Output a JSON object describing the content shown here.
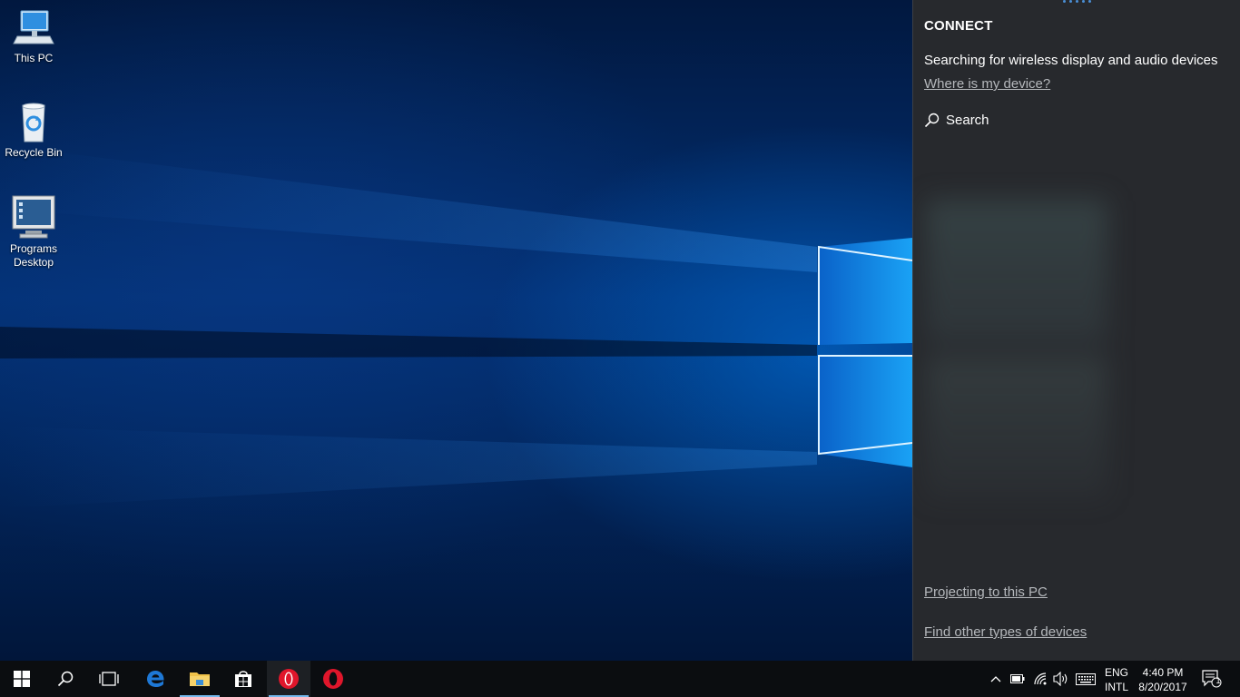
{
  "desktop": {
    "icons": [
      {
        "label": "This PC",
        "icon": "computer-icon"
      },
      {
        "label": "Recycle Bin",
        "icon": "recycle-bin-icon"
      },
      {
        "label": "Programs Desktop",
        "icon": "monitor-icon"
      }
    ]
  },
  "connect_panel": {
    "title": "CONNECT",
    "status": "Searching for wireless display and audio devices",
    "where_link": "Where is my device?",
    "search_label": "Search",
    "projecting_link": "Projecting to this PC",
    "find_link": "Find other types of devices"
  },
  "taskbar": {
    "pinned": [
      {
        "name": "start-button",
        "icon": "windows-logo-icon"
      },
      {
        "name": "search-button",
        "icon": "search-icon"
      },
      {
        "name": "task-view-button",
        "icon": "task-view-icon"
      },
      {
        "name": "edge-button",
        "icon": "edge-icon"
      },
      {
        "name": "file-explorer-button",
        "icon": "folder-icon"
      },
      {
        "name": "store-button",
        "icon": "store-icon"
      },
      {
        "name": "opera-button",
        "icon": "opera-icon"
      },
      {
        "name": "opera-button-2",
        "icon": "opera-icon"
      }
    ],
    "tray": {
      "language_top": "ENG",
      "language_bottom": "INTL",
      "time": "4:40 PM",
      "date": "8/20/2017",
      "notification_count": "1"
    },
    "colors": {
      "accent": "#76b9ed",
      "opera_red": "#e0162b",
      "edge_blue": "#1e78d6"
    }
  }
}
